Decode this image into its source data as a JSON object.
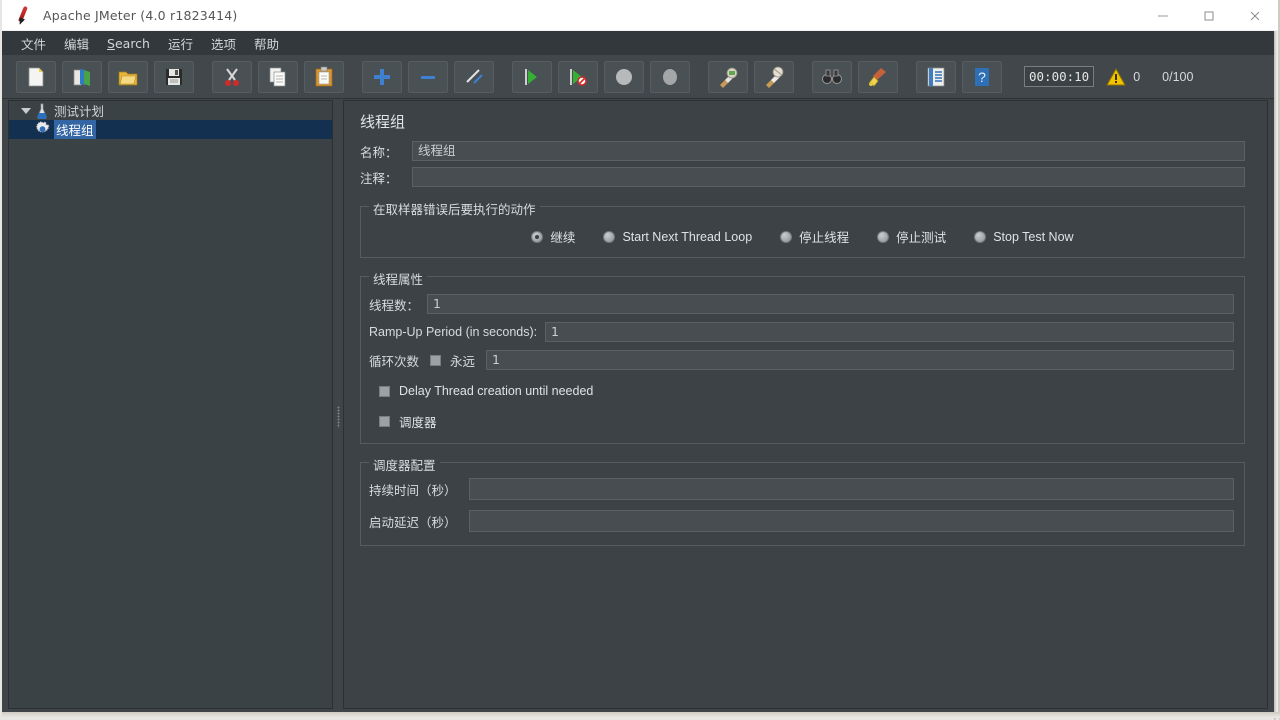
{
  "window": {
    "title": "Apache JMeter (4.0 r1823414)",
    "app_icon": "jmeter-feather-icon",
    "controls": {
      "minimize": "minimize-icon",
      "maximize": "maximize-icon",
      "close": "close-icon"
    }
  },
  "menubar": {
    "items": [
      {
        "label": "文件",
        "mnemonic": ""
      },
      {
        "label": "编辑",
        "mnemonic": ""
      },
      {
        "label": "Search",
        "mnemonic": "S"
      },
      {
        "label": "运行",
        "mnemonic": ""
      },
      {
        "label": "选项",
        "mnemonic": ""
      },
      {
        "label": "帮助",
        "mnemonic": ""
      }
    ]
  },
  "toolbar": {
    "buttons": [
      {
        "name": "new-icon",
        "tip": "New"
      },
      {
        "name": "templates-icon",
        "tip": "Templates"
      },
      {
        "name": "open-icon",
        "tip": "Open"
      },
      {
        "name": "save-icon",
        "tip": "Save"
      },
      {
        "name": "cut-icon",
        "tip": "Cut"
      },
      {
        "name": "copy-icon",
        "tip": "Copy"
      },
      {
        "name": "paste-icon",
        "tip": "Paste"
      },
      {
        "name": "expand-all-icon",
        "tip": "Expand All"
      },
      {
        "name": "collapse-all-icon",
        "tip": "Collapse All"
      },
      {
        "name": "toggle-icon",
        "tip": "Toggle"
      },
      {
        "name": "start-icon",
        "tip": "Start"
      },
      {
        "name": "start-no-pauses-icon",
        "tip": "Start no pauses"
      },
      {
        "name": "stop-icon",
        "tip": "Stop"
      },
      {
        "name": "shutdown-icon",
        "tip": "Shutdown"
      },
      {
        "name": "clear-icon",
        "tip": "Clear"
      },
      {
        "name": "clear-all-icon",
        "tip": "Clear All"
      },
      {
        "name": "search-icon",
        "tip": "Search"
      },
      {
        "name": "reset-search-icon",
        "tip": "Reset Search"
      },
      {
        "name": "function-helper-icon",
        "tip": "Function Helper Dialog"
      },
      {
        "name": "help-icon",
        "tip": "Help"
      }
    ],
    "timer": "00:00:10",
    "warning_icon": "warning-triangle-icon",
    "warning_count": "0",
    "run_count": "0/100"
  },
  "tree": {
    "nodes": [
      {
        "label": "测试计划",
        "icon": "test-plan-icon",
        "expanded": true,
        "selected": false,
        "depth": 0
      },
      {
        "label": "线程组",
        "icon": "thread-group-gear-icon",
        "expanded": false,
        "selected": true,
        "depth": 1
      }
    ]
  },
  "main": {
    "title": "线程组",
    "name_label": "名称：",
    "name_value": "线程组",
    "comment_label": "注释：",
    "comment_value": "",
    "on_error": {
      "legend": "在取样器错误后要执行的动作",
      "options": [
        {
          "label": "继续",
          "selected": true
        },
        {
          "label": "Start Next Thread Loop",
          "selected": false
        },
        {
          "label": "停止线程",
          "selected": false
        },
        {
          "label": "停止测试",
          "selected": false
        },
        {
          "label": "Stop Test Now",
          "selected": false
        }
      ]
    },
    "thread_properties": {
      "legend": "线程属性",
      "num_threads_label": "线程数：",
      "num_threads_value": "1",
      "ramp_up_label": "Ramp-Up Period (in seconds):",
      "ramp_up_value": "1",
      "loop_count_label": "循环次数",
      "forever_label": "永远",
      "forever_checked": false,
      "loop_count_value": "1",
      "delay_creation_label": "Delay Thread creation until needed",
      "delay_creation_checked": false,
      "scheduler_label": "调度器",
      "scheduler_checked": false
    },
    "scheduler_config": {
      "legend": "调度器配置",
      "duration_label": "持续时间（秒）",
      "duration_value": "",
      "startup_delay_label": "启动延迟（秒）",
      "startup_delay_value": ""
    }
  },
  "colors": {
    "panel_bg": "#3c4245",
    "toolbar_bg": "#41474b",
    "menubar_bg": "#32383b",
    "field_bg": "#474d51",
    "selection_blue": "#3465a4",
    "selection_row": "#143050",
    "text": "#d7dbde"
  }
}
